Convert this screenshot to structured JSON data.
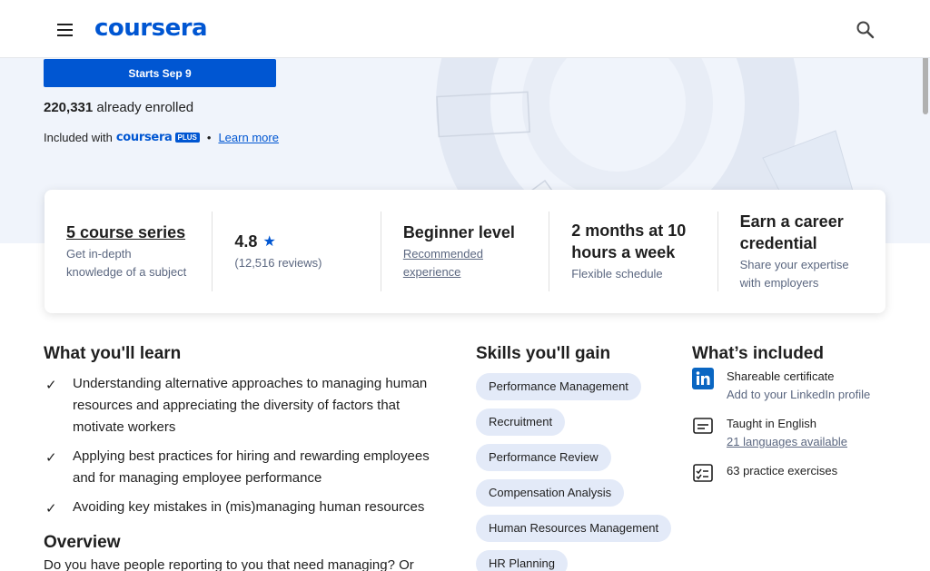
{
  "header": {
    "logo_text": "coursera",
    "menu_icon": "hamburger-menu-icon",
    "search_icon": "search-icon"
  },
  "hero": {
    "enroll_label": "Starts Sep 9",
    "enrolled_count": "220,331",
    "enrolled_text": "already enrolled",
    "included_prefix": "Included with",
    "plus_logo": "coursera",
    "plus_badge": "PLUS",
    "separator": "•",
    "learn_more": "Learn more"
  },
  "info_card": {
    "series": {
      "title": "5 course series",
      "subtitle": "Get in-depth knowledge of a subject"
    },
    "rating": {
      "value": "4.8",
      "reviews": "(12,516 reviews)"
    },
    "level": {
      "title": "Beginner level",
      "subtitle": "Recommended experience"
    },
    "schedule": {
      "title": "2 months at 10 hours a week",
      "subtitle": "Flexible schedule"
    },
    "credential": {
      "title": "Earn a career credential",
      "subtitle": "Share your expertise with employers"
    }
  },
  "learn": {
    "heading": "What you'll learn",
    "items": [
      "Understanding alternative approaches to managing human resources and appreciating the diversity of factors that motivate workers",
      "Applying best practices for hiring and rewarding employees and for managing employee performance",
      "Avoiding key mistakes in (mis)managing human resources"
    ]
  },
  "skills": {
    "heading": "Skills you'll gain",
    "items": [
      "Performance Management",
      "Recruitment",
      "Performance Review",
      "Compensation Analysis",
      "Human Resources Management",
      "HR Planning"
    ]
  },
  "included": {
    "heading": "What’s included",
    "certificate": {
      "title": "Shareable certificate",
      "subtitle": "Add to your LinkedIn profile"
    },
    "language": {
      "title": "Taught in English",
      "subtitle": "21 languages available"
    },
    "exercises": {
      "title": "63 practice exercises"
    }
  },
  "overview": {
    "heading": "Overview",
    "text": "Do you have people reporting to you that need managing? Or"
  },
  "colors": {
    "brand": "#0056d2",
    "hero_bg": "#f0f4fb",
    "pill_bg": "#e3eaf8",
    "muted_text": "#5b6780"
  }
}
